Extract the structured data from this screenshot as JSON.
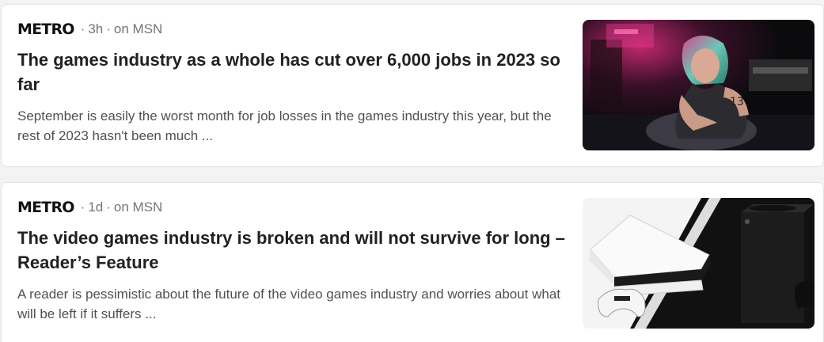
{
  "articles": [
    {
      "source": "METRO",
      "age": "3h",
      "platform": "on MSN",
      "title": "The games industry as a whole has cut over 6,000 jobs in 2023 so far",
      "snippet": "September is easily the worst month for job losses in the games industry this year, but the rest of 2023 hasn't been much ...",
      "thumbnail_icon": "cyberpunk-character-image"
    },
    {
      "source": "METRO",
      "age": "1d",
      "platform": "on MSN",
      "title": "The video games industry is broken and will not survive for long – Reader’s Feature",
      "snippet": "A reader is pessimistic about the future of the video games industry and worries about what will be left if it suffers ...",
      "thumbnail_icon": "game-consoles-image"
    }
  ],
  "colors": {
    "background": "#f1f3f4",
    "card": "#ffffff",
    "title": "#202124",
    "snippet": "#4d5156",
    "meta": "#70757a"
  }
}
